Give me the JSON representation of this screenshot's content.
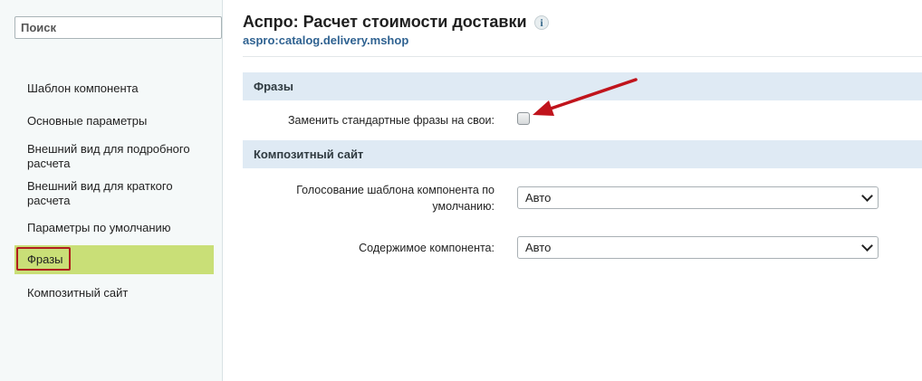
{
  "sidebar": {
    "search_placeholder": "Поиск",
    "items": [
      {
        "label": "Шаблон компонента"
      },
      {
        "label": "Основные параметры"
      },
      {
        "label": "Внешний вид для подробного расчета"
      },
      {
        "label": "Внешний вид для краткого расчета"
      },
      {
        "label": "Параметры по умолчанию"
      },
      {
        "label": "Фразы",
        "active": true
      },
      {
        "label": "Композитный сайт"
      }
    ]
  },
  "header": {
    "title": "Аспро: Расчет стоимости доставки",
    "info_icon": "info-icon",
    "component_code": "aspro:catalog.delivery.mshop"
  },
  "sections": [
    {
      "title": "Фразы",
      "fields": [
        {
          "label": "Заменить стандартные фразы на свои:",
          "type": "checkbox",
          "checked": false
        }
      ]
    },
    {
      "title": "Композитный сайт",
      "fields": [
        {
          "label": "Голосование шаблона компонента по умолчанию:",
          "type": "select",
          "value": "Авто"
        },
        {
          "label": "Содержимое компонента:",
          "type": "select",
          "value": "Авто"
        }
      ]
    }
  ],
  "colors": {
    "active_nav": "#c9df77",
    "highlight_border": "#b01e1e",
    "section_bg": "#dfeaf4",
    "link": "#2f6291"
  }
}
